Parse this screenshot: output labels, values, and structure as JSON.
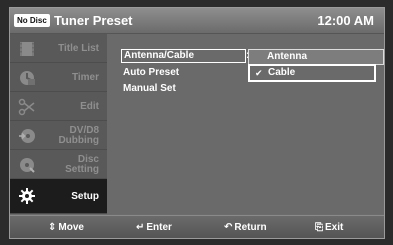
{
  "header": {
    "disc_badge": "No Disc",
    "title": "Tuner Preset",
    "clock": "12:00 AM"
  },
  "sidebar": {
    "items": [
      {
        "label": "Title List",
        "icon": "film-icon",
        "active": false
      },
      {
        "label": "Timer",
        "icon": "clock-icon",
        "active": false
      },
      {
        "label": "Edit",
        "icon": "scissors-icon",
        "active": false
      },
      {
        "label_line1": "DV/D8",
        "label_line2": "Dubbing",
        "icon": "dubbing-icon",
        "active": false
      },
      {
        "label_line1": "Disc",
        "label_line2": "Setting",
        "icon": "disc-icon",
        "active": false
      },
      {
        "label": "Setup",
        "icon": "gear-icon",
        "active": true
      }
    ]
  },
  "menu": {
    "rows": [
      "Antenna/Cable",
      "Auto Preset",
      "Manual Set"
    ],
    "colon": ":",
    "options": [
      "Antenna",
      "Cable"
    ],
    "checked_option": "Cable"
  },
  "footer": {
    "move": "Move",
    "enter": "Enter",
    "return": "Return",
    "exit": "Exit"
  },
  "colors": {
    "panel": "#6c6c6c",
    "sidebar": "#595959",
    "active_item": "#1c1c1c",
    "text": "#ffffff"
  }
}
